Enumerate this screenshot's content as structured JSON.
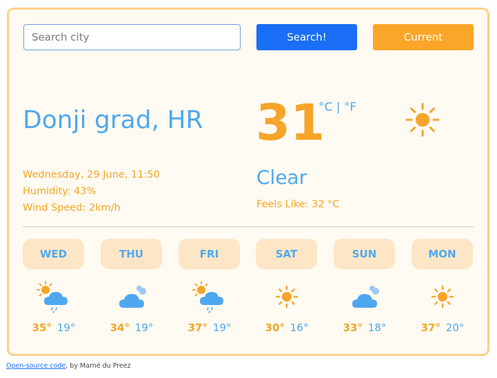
{
  "search": {
    "placeholder": "Search city",
    "value": ""
  },
  "buttons": {
    "search_label": "Search!",
    "current_label": "Current"
  },
  "location": {
    "city": "Donji grad, HR"
  },
  "details": {
    "datetime": "Wednesday, 29 June, 11:50",
    "humidity": "Humidity: 43%",
    "wind": "Wind Speed: 2km/h"
  },
  "current": {
    "temperature": "31",
    "unit_c": "°C",
    "separator": "|",
    "unit_f": "°F",
    "condition": "Clear",
    "feels_like": "Feels Like: 32 °C",
    "icon": "sun-icon"
  },
  "forecast": [
    {
      "day": "WED",
      "hi": "35°",
      "lo": "19°",
      "icon": "sun-cloud-rain-icon"
    },
    {
      "day": "THU",
      "hi": "34°",
      "lo": "19°",
      "icon": "cloud-icon"
    },
    {
      "day": "FRI",
      "hi": "37°",
      "lo": "19°",
      "icon": "sun-cloud-rain-icon"
    },
    {
      "day": "SAT",
      "hi": "30°",
      "lo": "16°",
      "icon": "sun-icon"
    },
    {
      "day": "SUN",
      "hi": "33°",
      "lo": "18°",
      "icon": "cloud-icon"
    },
    {
      "day": "MON",
      "hi": "37°",
      "lo": "20°",
      "icon": "sun-icon"
    }
  ],
  "footer": {
    "link_text": "Open-source code",
    "text": ", by Marné du Preez"
  },
  "colors": {
    "accent_blue": "#4ea8f0",
    "accent_orange": "#f7a42a",
    "button_blue": "#1a6ef5",
    "button_orange": "#fba629"
  }
}
